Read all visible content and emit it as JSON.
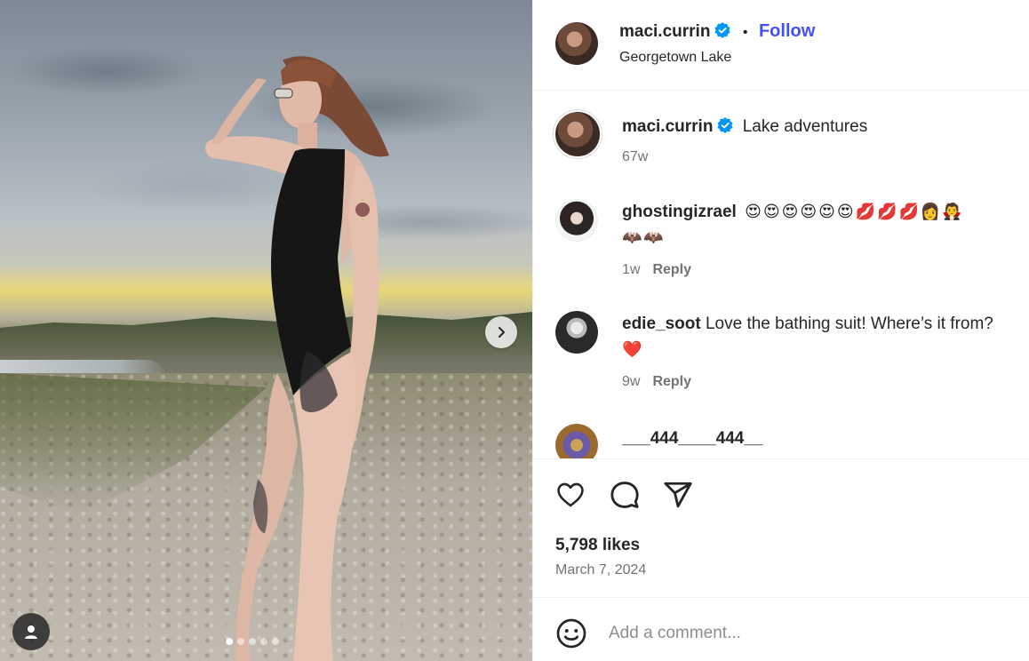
{
  "post": {
    "author": "maci.currin",
    "follow_label": "Follow",
    "separator": "•",
    "location": "Georgetown Lake",
    "caption_author": "maci.currin",
    "caption": "Lake adventures",
    "caption_age": "67w",
    "likes": "5,798 likes",
    "date": "March 7, 2024"
  },
  "comments": [
    {
      "user": "ghostingizrael",
      "text": "😍😍😍😍😍😍💋💋💋👩🧛",
      "text2": "🦇🦇",
      "age": "1w",
      "reply_label": "Reply"
    },
    {
      "user": "edie_soot",
      "text": "Love the bathing suit! Where’s it from?",
      "text2": "❤️",
      "age": "9w",
      "reply_label": "Reply"
    },
    {
      "user": "___444____444__",
      "text": "",
      "age": "",
      "reply_label": ""
    }
  ],
  "composer": {
    "placeholder": "Add a comment..."
  },
  "carousel": {
    "slide_count": 5,
    "active_index": 0
  },
  "icons": {
    "verified": "verified-badge-icon",
    "like": "heart-icon",
    "comment": "comment-bubble-icon",
    "share": "paper-plane-icon",
    "emoji": "smiley-icon",
    "next": "chevron-right-icon",
    "tag": "user-tag-icon"
  },
  "colors": {
    "verified": "#0095f6",
    "follow": "#4150f7"
  }
}
